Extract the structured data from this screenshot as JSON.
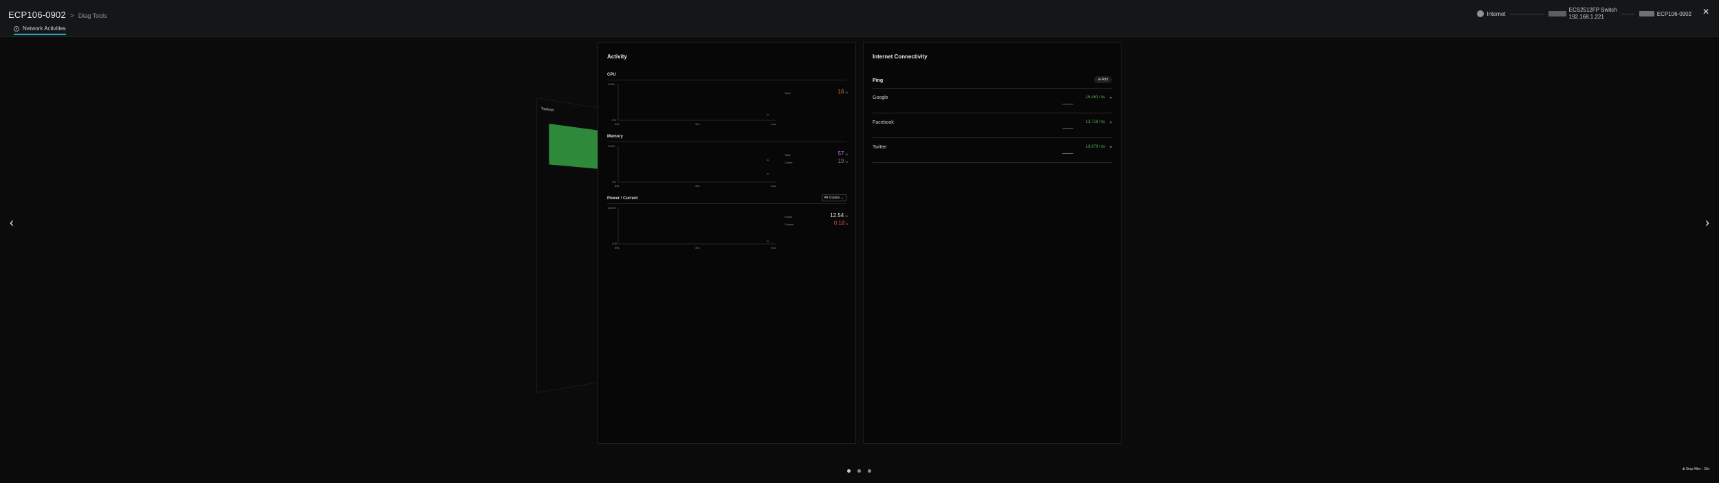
{
  "header": {
    "title": "ECP106-0902",
    "separator": ">",
    "subtitle": "Diag Tools",
    "tab_label": "Network Activities"
  },
  "topology": {
    "internet": "Internet",
    "switch_name": "ECS2512FP Switch",
    "switch_ip": "192.168.1.221",
    "device_name": "ECP106-0902"
  },
  "activity": {
    "title": "Activity",
    "cpu": {
      "title": "CPU",
      "y_top": "100%",
      "y_bottom": "0%",
      "x_ticks": [
        "60s",
        "30s",
        "now"
      ],
      "total_label": "Total",
      "total_value": "16",
      "unit": "%"
    },
    "memory": {
      "title": "Memory",
      "y_top": "100%",
      "y_bottom": "0%",
      "x_ticks": [
        "60s",
        "30s",
        "now"
      ],
      "total_label": "Total",
      "total_value": "57",
      "cache_label": "Cache",
      "cache_value": "19",
      "unit": "%"
    },
    "power": {
      "title": "Power / Current",
      "dropdown": "All Outlets",
      "y_top": "230 W",
      "y_bottom": "0 W",
      "x_ticks": [
        "60s",
        "30s",
        "now"
      ],
      "power_label": "Power",
      "power_value": "12.54",
      "power_unit": "W",
      "current_label": "Current",
      "current_value": "0.18",
      "current_unit": "A"
    }
  },
  "internet": {
    "title": "Internet Connectivity",
    "ping_label": "Ping",
    "add_label": "Add",
    "rows": [
      {
        "name": "Google",
        "ms": "16.463 ms"
      },
      {
        "name": "Facebook",
        "ms": "13.718 ms"
      },
      {
        "name": "Twitter",
        "ms": "18.979 ms"
      }
    ]
  },
  "ghost_panel": {
    "title": "Topload"
  },
  "footer": {
    "stop_label": "Stop After : 30s"
  }
}
